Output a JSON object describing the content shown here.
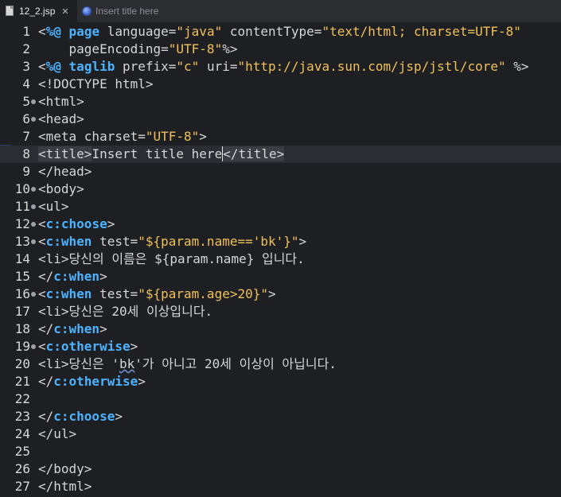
{
  "tabs": [
    {
      "label": "12_2.jsp",
      "close": "✕",
      "icon": "jsp-file-icon",
      "active": true
    },
    {
      "label": "Insert title here",
      "icon": "browser-globe-icon",
      "active": false
    }
  ],
  "colors": {
    "background": "#1e1f22",
    "keyword": "#4db3ff",
    "string": "#f0c15a",
    "text": "#d6d6d6"
  },
  "editor": {
    "current_line": 8,
    "lines": [
      {
        "n": "1",
        "parts": [
          [
            "t",
            "<"
          ],
          [
            "k",
            "%@"
          ],
          [
            "t",
            " "
          ],
          [
            "k",
            "page"
          ],
          [
            "a",
            " language="
          ],
          [
            "s",
            "\"java\""
          ],
          [
            "a",
            " contentType="
          ],
          [
            "s",
            "\"text/html; charset=UTF-8\""
          ]
        ]
      },
      {
        "n": "2",
        "parts": [
          [
            "a",
            "    pageEncoding="
          ],
          [
            "s",
            "\"UTF-8\""
          ],
          [
            "t",
            "%>"
          ]
        ]
      },
      {
        "n": "3",
        "parts": [
          [
            "t",
            "<"
          ],
          [
            "k",
            "%@"
          ],
          [
            "t",
            " "
          ],
          [
            "k",
            "taglib"
          ],
          [
            "a",
            " prefix="
          ],
          [
            "s",
            "\"c\""
          ],
          [
            "a",
            " uri="
          ],
          [
            "s",
            "\"http://java.sun.com/jsp/jstl/core\""
          ],
          [
            "t",
            " %>"
          ]
        ]
      },
      {
        "n": "4",
        "parts": [
          [
            "t",
            "<!DOCTYPE html>"
          ]
        ]
      },
      {
        "n": "5",
        "fold": true,
        "parts": [
          [
            "t",
            "<html>"
          ]
        ]
      },
      {
        "n": "6",
        "fold": true,
        "parts": [
          [
            "t",
            "<head>"
          ]
        ]
      },
      {
        "n": "7",
        "parts": [
          [
            "t",
            "<meta charset="
          ],
          [
            "s",
            "\"UTF-8\""
          ],
          [
            "t",
            ">"
          ]
        ]
      },
      {
        "n": "8",
        "parts": [
          [
            "hl",
            "<title>"
          ],
          [
            "t",
            "Insert title here"
          ],
          [
            "hl",
            "</title>"
          ]
        ]
      },
      {
        "n": "9",
        "parts": [
          [
            "t",
            "</head>"
          ]
        ]
      },
      {
        "n": "10",
        "fold": true,
        "parts": [
          [
            "t",
            "<body>"
          ]
        ]
      },
      {
        "n": "11",
        "fold": true,
        "parts": [
          [
            "t",
            "<ul>"
          ]
        ]
      },
      {
        "n": "12",
        "fold": true,
        "parts": [
          [
            "t",
            "<"
          ],
          [
            "k",
            "c:choose"
          ],
          [
            "t",
            ">"
          ]
        ]
      },
      {
        "n": "13",
        "fold": true,
        "parts": [
          [
            "t",
            "<"
          ],
          [
            "k",
            "c:when"
          ],
          [
            "a",
            " test="
          ],
          [
            "s",
            "\"${param.name=='bk'}\""
          ],
          [
            "t",
            ">"
          ]
        ]
      },
      {
        "n": "14",
        "parts": [
          [
            "t",
            "<li>당신의 이름은 ${param.name} 입니다."
          ]
        ]
      },
      {
        "n": "15",
        "parts": [
          [
            "t",
            "</"
          ],
          [
            "k",
            "c:when"
          ],
          [
            "t",
            ">"
          ]
        ]
      },
      {
        "n": "16",
        "fold": true,
        "parts": [
          [
            "t",
            "<"
          ],
          [
            "k",
            "c:when"
          ],
          [
            "a",
            " test="
          ],
          [
            "s",
            "\"${param.age>20}\""
          ],
          [
            "t",
            ">"
          ]
        ]
      },
      {
        "n": "17",
        "parts": [
          [
            "t",
            "<li>당신은 20세 이상입니다."
          ]
        ]
      },
      {
        "n": "18",
        "parts": [
          [
            "t",
            "</"
          ],
          [
            "k",
            "c:when"
          ],
          [
            "t",
            ">"
          ]
        ]
      },
      {
        "n": "19",
        "fold": true,
        "parts": [
          [
            "t",
            "<"
          ],
          [
            "k",
            "c:otherwise"
          ],
          [
            "t",
            ">"
          ]
        ]
      },
      {
        "n": "20",
        "parts": [
          [
            "t",
            "<li>당신은 '"
          ],
          [
            "sq",
            "bk"
          ],
          [
            "t",
            "'가 아니고 20세 이상이 아닙니다."
          ]
        ]
      },
      {
        "n": "21",
        "parts": [
          [
            "t",
            "</"
          ],
          [
            "k",
            "c:otherwise"
          ],
          [
            "t",
            ">"
          ]
        ]
      },
      {
        "n": "22",
        "parts": []
      },
      {
        "n": "23",
        "parts": [
          [
            "t",
            "</"
          ],
          [
            "k",
            "c:choose"
          ],
          [
            "t",
            ">"
          ]
        ]
      },
      {
        "n": "24",
        "parts": [
          [
            "t",
            "</ul>"
          ]
        ]
      },
      {
        "n": "25",
        "parts": []
      },
      {
        "n": "26",
        "parts": [
          [
            "t",
            "</body>"
          ]
        ]
      },
      {
        "n": "27",
        "parts": [
          [
            "t",
            "</html>"
          ]
        ]
      }
    ]
  }
}
